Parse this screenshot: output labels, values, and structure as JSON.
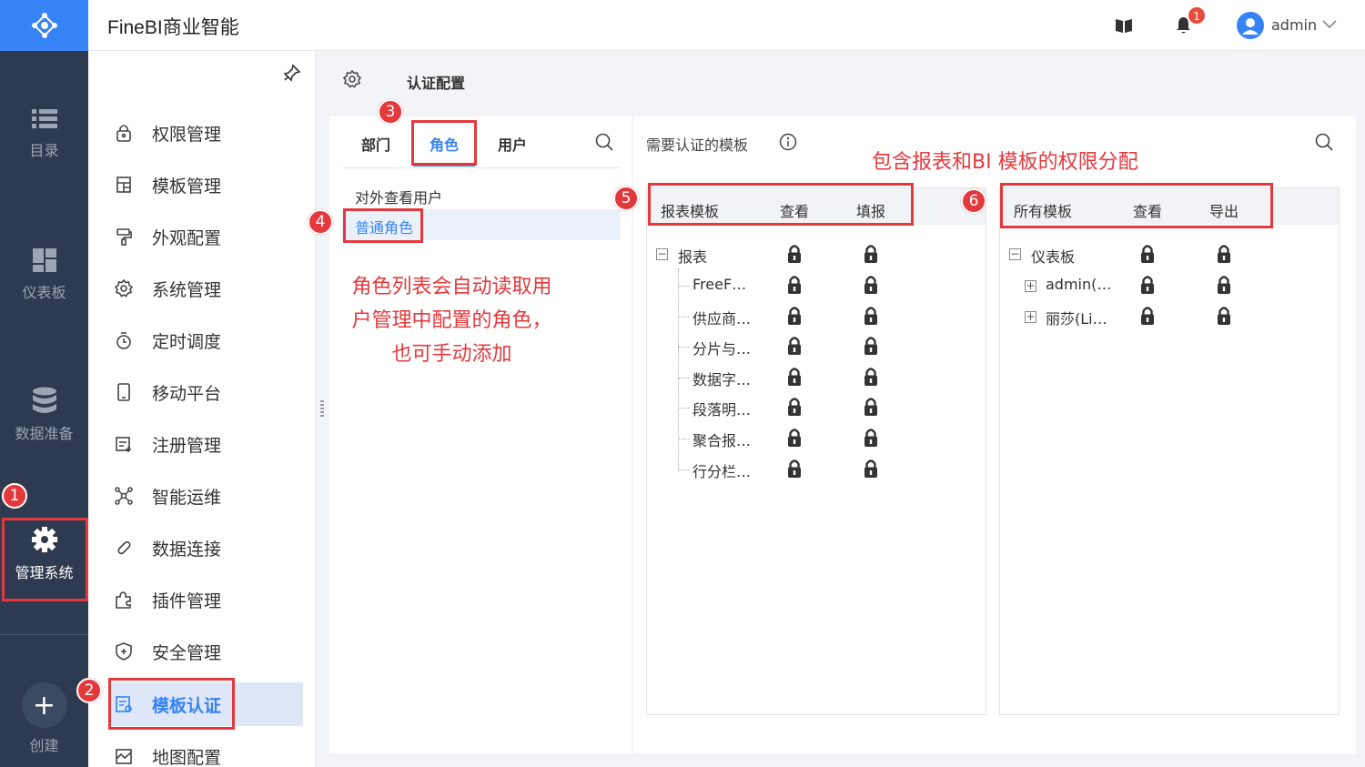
{
  "app": {
    "title": "FineBI商业智能",
    "user": "admin",
    "notification_count": "1"
  },
  "rail": {
    "items": [
      {
        "label": "目录",
        "icon": "list-icon"
      },
      {
        "label": "仪表板",
        "icon": "dashboard-icon"
      },
      {
        "label": "数据准备",
        "icon": "database-icon"
      },
      {
        "label": "管理系统",
        "icon": "gear-icon"
      }
    ],
    "create_label": "创建"
  },
  "menu": {
    "items": [
      {
        "label": "权限管理",
        "icon": "lock-icon"
      },
      {
        "label": "模板管理",
        "icon": "template-icon"
      },
      {
        "label": "外观配置",
        "icon": "paint-icon"
      },
      {
        "label": "系统管理",
        "icon": "gear-icon"
      },
      {
        "label": "定时调度",
        "icon": "timer-icon"
      },
      {
        "label": "移动平台",
        "icon": "mobile-icon"
      },
      {
        "label": "注册管理",
        "icon": "register-icon"
      },
      {
        "label": "智能运维",
        "icon": "ops-icon"
      },
      {
        "label": "数据连接",
        "icon": "link-icon"
      },
      {
        "label": "插件管理",
        "icon": "plugin-icon"
      },
      {
        "label": "安全管理",
        "icon": "shield-icon"
      },
      {
        "label": "模板认证",
        "icon": "cert-icon"
      },
      {
        "label": "地图配置",
        "icon": "map-icon"
      }
    ],
    "active_index": 11
  },
  "page": {
    "title": "认证配置"
  },
  "roles_panel": {
    "tabs": [
      "部门",
      "角色",
      "用户"
    ],
    "active_tab": "角色",
    "roles": [
      "对外查看用户",
      "普通角色"
    ],
    "selected_role": "普通角色"
  },
  "templates_panel": {
    "heading": "需要认证的模板",
    "report_table": {
      "headers": [
        "报表模板",
        "查看",
        "填报"
      ],
      "root": "报表",
      "children": [
        "FreeF…",
        "供应商…",
        "分片与…",
        "数据字…",
        "段落明…",
        "聚合报…",
        "行分栏…"
      ]
    },
    "dashboard_table": {
      "headers": [
        "所有模板",
        "查看",
        "导出"
      ],
      "root": "仪表板",
      "children": [
        "admin(…",
        "丽莎(Li…"
      ]
    }
  },
  "annotations": {
    "roles_note": [
      "角色列表会自动读取用",
      "户管理中配置的角色，",
      "也可手动添加"
    ],
    "template_note": "包含报表和BI 模板的权限分配",
    "markers": [
      "1",
      "2",
      "3",
      "4",
      "5",
      "6"
    ]
  },
  "colors": {
    "accent": "#3583f5",
    "rail": "#2d3a4f",
    "annotation": "#e4393c"
  }
}
